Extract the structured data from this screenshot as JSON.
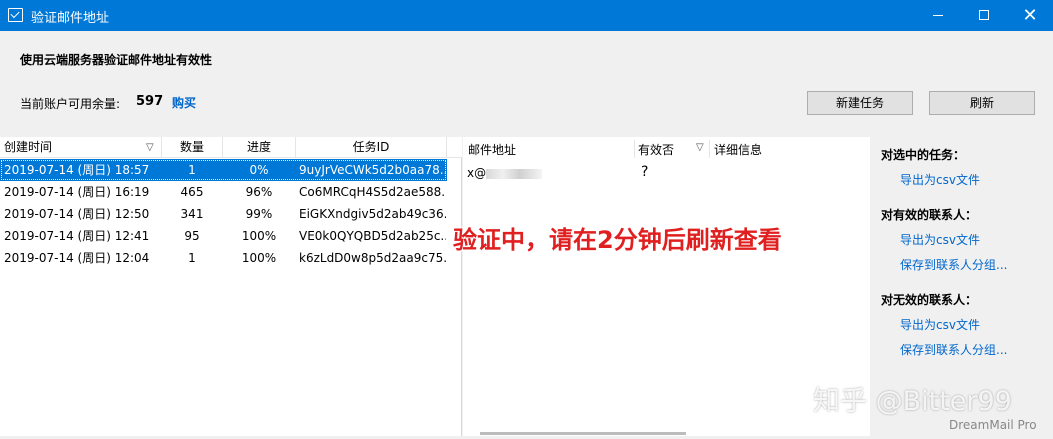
{
  "window": {
    "title": "验证邮件地址",
    "controls": {
      "minimize": "minimize",
      "maximize": "maximize",
      "close": "✕"
    }
  },
  "header": {
    "heading": "使用云端服务器验证邮件地址有效性",
    "balance_label": "当前账户可用余量:",
    "balance_value": "597",
    "buy_link": "购买"
  },
  "toolbar": {
    "new_task": "新建任务",
    "refresh": "刷新"
  },
  "tasks_table": {
    "columns": [
      "创建时间",
      "数量",
      "进度",
      "任务ID"
    ],
    "sort_indicator": "▽",
    "rows": [
      {
        "date": "2019-07-14 (周日) 18:57",
        "count": "1",
        "progress": "0%",
        "id": "9uyJrVeCWk5d2b0aa78...",
        "selected": true
      },
      {
        "date": "2019-07-14 (周日) 16:19",
        "count": "465",
        "progress": "96%",
        "id": "Co6MRCqH4S5d2ae588...",
        "selected": false
      },
      {
        "date": "2019-07-14 (周日) 12:50",
        "count": "341",
        "progress": "99%",
        "id": "EiGKXndgiv5d2ab49c36...",
        "selected": false
      },
      {
        "date": "2019-07-14 (周日) 12:41",
        "count": "95",
        "progress": "100%",
        "id": "VE0k0QYQBD5d2ab25c...",
        "selected": false
      },
      {
        "date": "2019-07-14 (周日) 12:04",
        "count": "1",
        "progress": "100%",
        "id": "k6zLdD0w8p5d2aa9c75...",
        "selected": false
      }
    ]
  },
  "results_table": {
    "columns": [
      "邮件地址",
      "有效否",
      "详细信息"
    ],
    "sort_indicator": "▽",
    "rows": [
      {
        "email": "x@",
        "valid": "?"
      }
    ]
  },
  "overlay_text": "验证中，请在2分钟后刷新查看",
  "sidebar": {
    "groups": [
      {
        "heading": "对选中的任务：",
        "links": [
          "导出为csv文件"
        ]
      },
      {
        "heading": "对有效的联系人：",
        "links": [
          "导出为csv文件",
          "保存到联系人分组..."
        ]
      },
      {
        "heading": "对无效的联系人：",
        "links": [
          "导出为csv文件",
          "保存到联系人分组..."
        ]
      }
    ]
  },
  "watermark": "知乎 @Bitter99",
  "brand": "DreamMail Pro",
  "colors": {
    "accent": "#0078d7",
    "link": "#0066cc",
    "overlay": "#e02020"
  }
}
